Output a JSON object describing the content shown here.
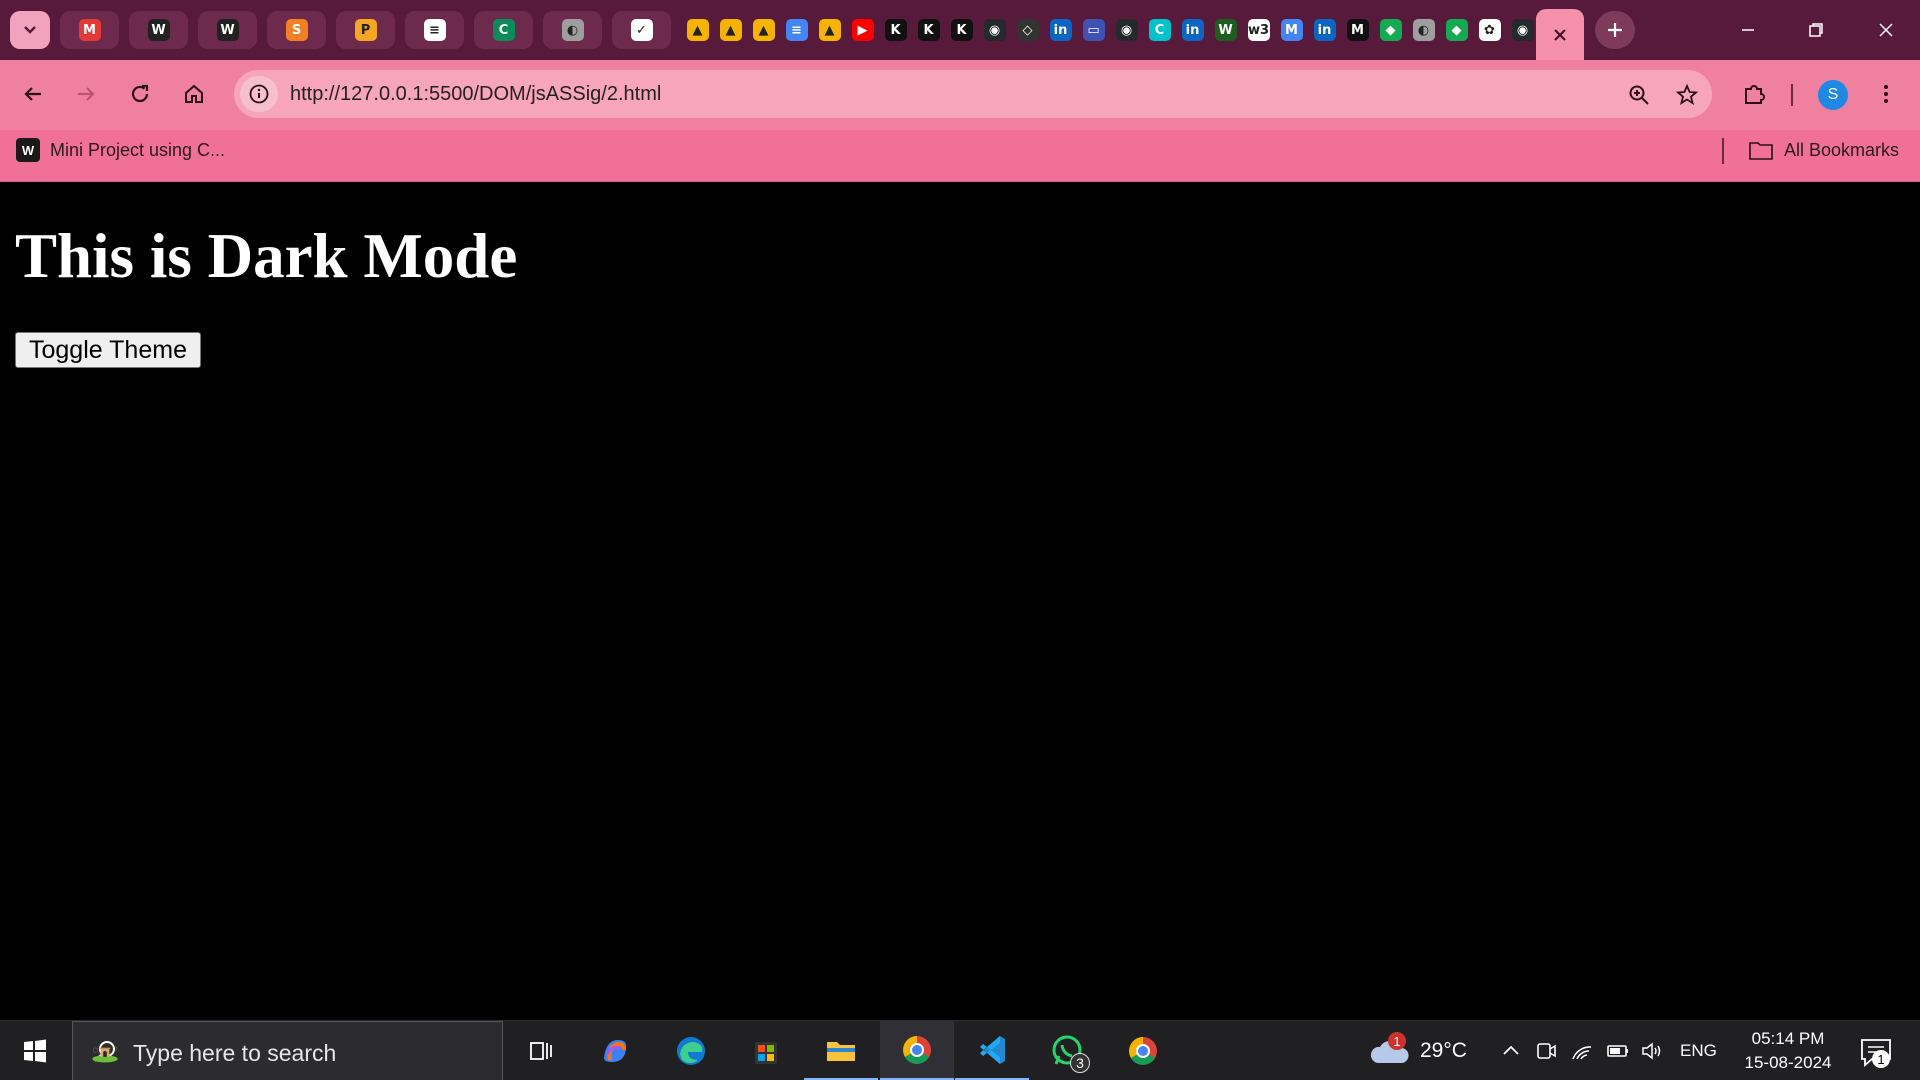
{
  "browser": {
    "url": "http://127.0.0.1:5500/DOM/jsASSig/2.html",
    "profile_initial": "S",
    "tabs_wide": [
      {
        "icon": "gmail-icon",
        "color": "#e53935",
        "glyph": "M"
      },
      {
        "icon": "wordpress-icon",
        "color": "#222222",
        "glyph": "W"
      },
      {
        "icon": "wordpress-icon",
        "color": "#222222",
        "glyph": "W"
      },
      {
        "icon": "stackoverflow-icon",
        "color": "#f48024",
        "glyph": "S"
      },
      {
        "icon": "plugin-icon",
        "color": "#f5a623",
        "glyph": "P"
      },
      {
        "icon": "document-icon",
        "color": "#ffffff",
        "glyph": "≡"
      },
      {
        "icon": "codechef-icon",
        "color": "#0b8a5a",
        "glyph": "C"
      },
      {
        "icon": "globe-icon",
        "color": "#9e9e9e",
        "glyph": "◐"
      },
      {
        "icon": "check-icon",
        "color": "#ffffff",
        "glyph": "✓"
      }
    ],
    "tabs_pinned": [
      {
        "icon": "google-drive-icon",
        "color": "#f4b400",
        "glyph": "▲"
      },
      {
        "icon": "google-drive-icon",
        "color": "#f4b400",
        "glyph": "▲"
      },
      {
        "icon": "google-drive-icon",
        "color": "#f4b400",
        "glyph": "▲"
      },
      {
        "icon": "google-docs-icon",
        "color": "#4285f4",
        "glyph": "≡"
      },
      {
        "icon": "google-drive-icon",
        "color": "#f4b400",
        "glyph": "▲"
      },
      {
        "icon": "youtube-icon",
        "color": "#ff0000",
        "glyph": "▶"
      },
      {
        "icon": "k-icon",
        "color": "#111111",
        "glyph": "K"
      },
      {
        "icon": "k-icon",
        "color": "#111111",
        "glyph": "K"
      },
      {
        "icon": "k-icon",
        "color": "#111111",
        "glyph": "K"
      },
      {
        "icon": "github-icon",
        "color": "#24292e",
        "glyph": "◉"
      },
      {
        "icon": "code-icon",
        "color": "#333333",
        "glyph": "◇"
      },
      {
        "icon": "linkedin-icon",
        "color": "#0a66c2",
        "glyph": "in"
      },
      {
        "icon": "forms-icon",
        "color": "#3f51b5",
        "glyph": "▭"
      },
      {
        "icon": "github-icon",
        "color": "#24292e",
        "glyph": "◉"
      },
      {
        "icon": "canva-icon",
        "color": "#00c4cc",
        "glyph": "C"
      },
      {
        "icon": "linkedin-icon",
        "color": "#0a66c2",
        "glyph": "in"
      },
      {
        "icon": "w-icon",
        "color": "#1b5e20",
        "glyph": "W"
      },
      {
        "icon": "w3schools-icon",
        "color": "#ffffff",
        "glyph": "w3"
      },
      {
        "icon": "gmail-icon",
        "color": "#4285f4",
        "glyph": "M"
      },
      {
        "icon": "linkedin-icon",
        "color": "#0a66c2",
        "glyph": "in"
      },
      {
        "icon": "medium-icon",
        "color": "#111111",
        "glyph": "M"
      },
      {
        "icon": "mongodb-icon",
        "color": "#13aa52",
        "glyph": "◆"
      },
      {
        "icon": "globe-icon",
        "color": "#9e9e9e",
        "glyph": "◐"
      },
      {
        "icon": "mongodb-icon",
        "color": "#13aa52",
        "glyph": "◆"
      },
      {
        "icon": "chatgpt-icon",
        "color": "#ffffff",
        "glyph": "✿"
      },
      {
        "icon": "github-icon",
        "color": "#24292e",
        "glyph": "◉"
      }
    ]
  },
  "bookmarks": {
    "item_label": "Mini Project using C...",
    "all_bookmarks": "All Bookmarks"
  },
  "page": {
    "heading": "This is Dark Mode",
    "toggle_button": "Toggle Theme"
  },
  "taskbar": {
    "search_placeholder": "Type here to search",
    "whatsapp_badge": "3",
    "weather_badge": "1",
    "temperature": "29°C",
    "language": "ENG",
    "time": "05:14 PM",
    "date": "15-08-2024",
    "notification_count": "1"
  },
  "colors": {
    "tabstrip_bg": "#571a3a",
    "toolbar_bg": "#f0809f",
    "page_bg": "#000000",
    "page_text": "#ffffff"
  }
}
